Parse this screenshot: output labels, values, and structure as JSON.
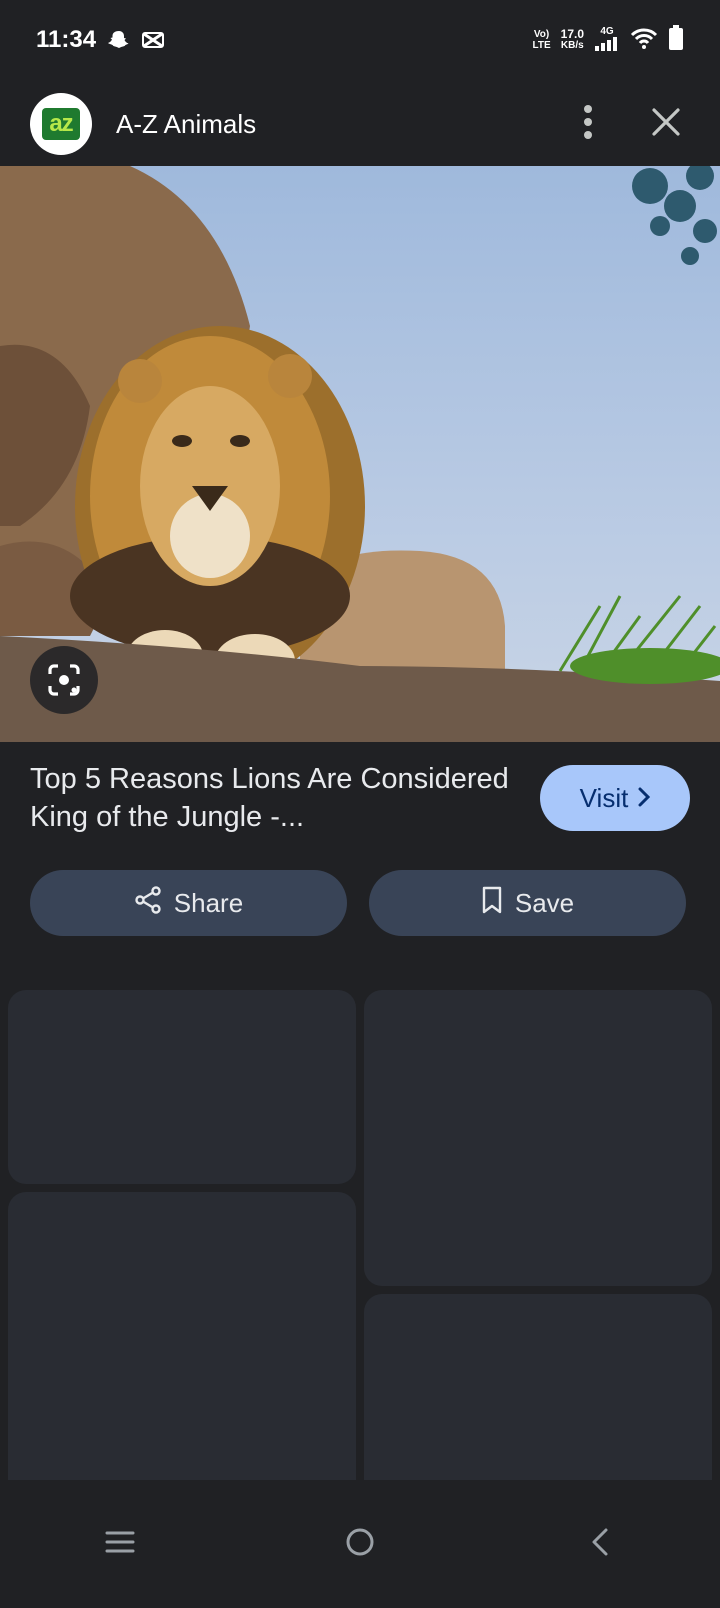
{
  "status_bar": {
    "time": "11:34",
    "net_top": "Vo)",
    "net_bottom": "LTE",
    "speed_value": "17.0",
    "speed_unit": "KB/s",
    "network_type": "4G",
    "icons": [
      "snapchat-icon",
      "capcut-icon",
      "signal-icon",
      "wifi-icon",
      "battery-icon"
    ]
  },
  "header": {
    "logo_text": "az",
    "site_name": "A-Z Animals",
    "icons": [
      "more-vert-icon",
      "close-icon"
    ]
  },
  "result": {
    "title": "Top 5 Reasons Lions Are Considered King of the Jungle -...",
    "visit_label": "Visit",
    "share_label": "Share",
    "save_label": "Save"
  },
  "nav": {
    "icons": [
      "recents-icon",
      "home-icon",
      "back-icon"
    ]
  },
  "colors": {
    "background": "#202124",
    "visit_button": "#a8c7fa",
    "action_button": "#394457",
    "placeholder": "#292c33"
  }
}
